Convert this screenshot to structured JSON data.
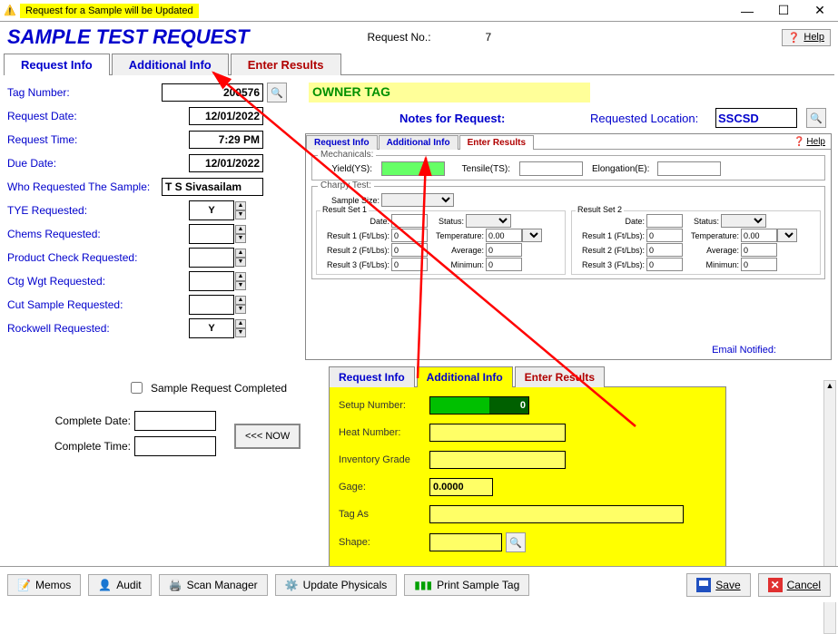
{
  "titlebar": {
    "text": "Request for a Sample will be Updated"
  },
  "header": {
    "title": "SAMPLE TEST REQUEST",
    "req_no_label": "Request No.:",
    "req_no_value": "7",
    "help": "Help"
  },
  "main_tabs": {
    "request_info": "Request Info",
    "additional_info": "Additional Info",
    "enter_results": "Enter Results"
  },
  "left_form": {
    "tag_number_label": "Tag Number:",
    "tag_number_value": "200576",
    "owner_tag": "OWNER TAG",
    "request_date_label": "Request Date:",
    "request_date_value": "12/01/2022",
    "request_time_label": "Request Time:",
    "request_time_value": "7:29 PM",
    "due_date_label": "Due Date:",
    "due_date_value": "12/01/2022",
    "who_requested_label": "Who Requested The Sample:",
    "who_requested_value": "T S Sivasailam",
    "tye_label": "TYE Requested:",
    "tye_value": "Y",
    "chems_label": "Chems Requested:",
    "chems_value": "",
    "product_check_label": "Product Check Requested:",
    "product_check_value": "",
    "ctg_wgt_label": "Ctg Wgt Requested:",
    "ctg_wgt_value": "",
    "cut_sample_label": "Cut Sample Requested:",
    "cut_sample_value": "",
    "rockwell_label": "Rockwell Requested:",
    "rockwell_value": "Y"
  },
  "notes_label": "Notes for Request:",
  "requested_location_label": "Requested Location:",
  "requested_location_value": "SSCSD",
  "enter_results_panel": {
    "tabs": {
      "ri": "Request Info",
      "ai": "Additional Info",
      "er": "Enter Results"
    },
    "help": "Help",
    "mech_legend": "Mechanicals:",
    "yield_label": "Yield(YS):",
    "tensile_label": "Tensile(TS):",
    "elong_label": "Elongation(E):",
    "charpy_legend": "Charpy Test:",
    "sample_size_label": "Sample Size:",
    "rs1_legend": "Result Set 1",
    "rs2_legend": "Result Set 2",
    "date_label": "Date:",
    "status_label": "Status:",
    "result1_label": "Result 1 (Ft/Lbs):",
    "result2_label": "Result 2 (Ft/Lbs):",
    "result3_label": "Result 3 (Ft/Lbs):",
    "temperature_label": "Temperature:",
    "average_label": "Average:",
    "minimum_label": "Minimun:",
    "zero": "0",
    "zerozz": "0.00",
    "email_notified": "Email Notified:"
  },
  "completed_area": {
    "checkbox_label": "Sample Request Completed",
    "complete_date_label": "Complete Date:",
    "complete_time_label": "Complete Time:",
    "now_btn": "<<< NOW"
  },
  "additional_info_panel": {
    "tabs": {
      "ri": "Request Info",
      "ai": "Additional Info",
      "er": "Enter Results"
    },
    "setup_number_label": "Setup Number:",
    "setup_number_value": "0",
    "heat_number_label": "Heat Number:",
    "heat_number_value": "",
    "inventory_grade_label": "Inventory Grade",
    "inventory_grade_value": "",
    "gage_label": "Gage:",
    "gage_value": "0.0000",
    "tag_as_label": "Tag As",
    "tag_as_value": "",
    "shape_label": "Shape:",
    "shape_value": ""
  },
  "bottom_bar": {
    "memos": "Memos",
    "audit": "Audit",
    "scan_manager": "Scan Manager",
    "update_physicals": "Update Physicals",
    "print_sample_tag": "Print Sample Tag",
    "save": "Save",
    "cancel": "Cancel"
  }
}
